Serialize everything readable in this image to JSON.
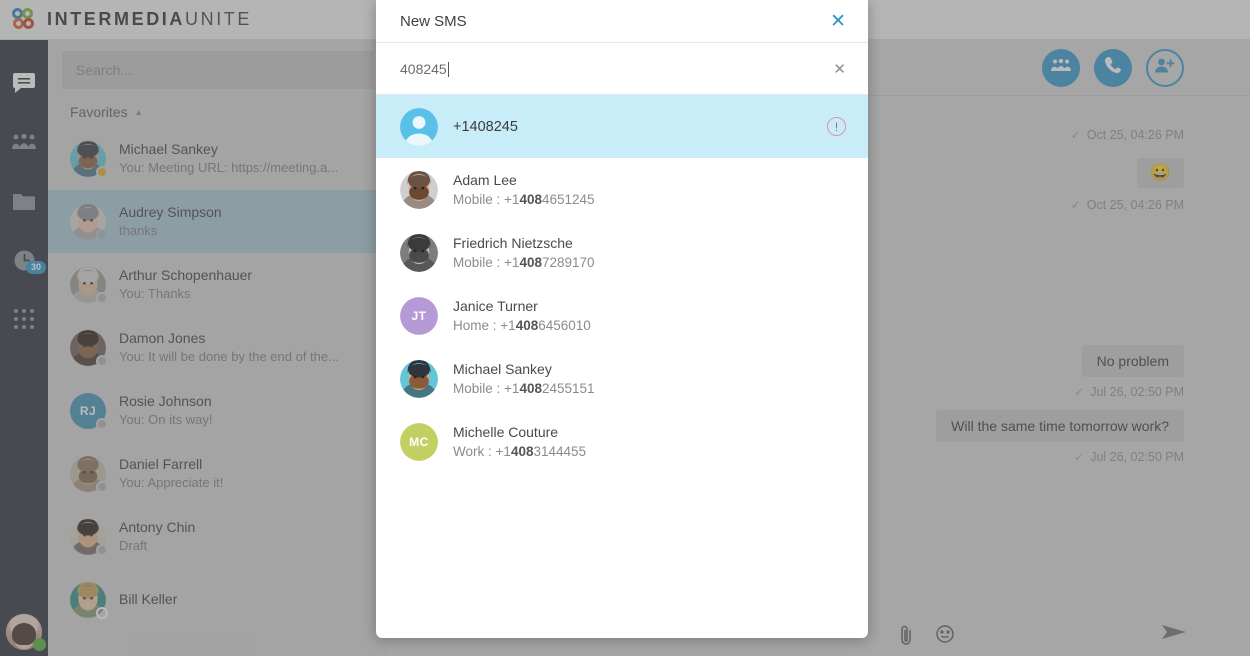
{
  "brand": {
    "name_bold": "INTERMEDIA",
    "name_light": "UNITE"
  },
  "rail": {
    "items": [
      {
        "name": "chat-icon",
        "label": "Chat",
        "badge": ""
      },
      {
        "name": "contacts-icon",
        "label": "Contacts",
        "badge": ""
      },
      {
        "name": "files-icon",
        "label": "Files",
        "badge": ""
      },
      {
        "name": "history-icon",
        "label": "History",
        "badge": "30"
      },
      {
        "name": "dialpad-icon",
        "label": "Dialpad",
        "badge": ""
      }
    ]
  },
  "sidebar": {
    "search_placeholder": "Search...",
    "section_title": "Favorites",
    "conversations": [
      {
        "name": "Michael Sankey",
        "sub": "You: Meeting URL: https://meeting.a...",
        "presence": "away",
        "avatar": "photo-sankey",
        "selected": false
      },
      {
        "name": "Audrey Simpson",
        "sub": "thanks",
        "presence": "offline-grey",
        "avatar": "photo-audrey",
        "selected": true
      },
      {
        "name": "Arthur Schopenhauer",
        "sub": "You: Thanks",
        "presence": "offline-grey",
        "avatar": "photo-arthur",
        "selected": false
      },
      {
        "name": "Damon Jones",
        "sub": "You: It will be done by the end of the...",
        "presence": "offline-grey",
        "avatar": "photo-damon",
        "selected": false
      },
      {
        "name": "Rosie Johnson",
        "sub": "You: On its way!",
        "presence": "offline-grey",
        "avatar": "initials",
        "initials": "RJ",
        "color": "#3f92b5",
        "selected": false
      },
      {
        "name": "Daniel Farrell",
        "sub": "You: Appreciate it!",
        "presence": "offline-grey",
        "avatar": "photo-daniel",
        "selected": false
      },
      {
        "name": "Antony Chin",
        "sub": "Draft",
        "presence": "offline-grey",
        "avatar": "photo-antony",
        "selected": false
      },
      {
        "name": "Bill Keller",
        "sub": "",
        "presence": "offline",
        "avatar": "photo-bill",
        "selected": false
      }
    ]
  },
  "chat": {
    "actions": [
      {
        "name": "meeting-button",
        "icon": "people-icon"
      },
      {
        "name": "call-button",
        "icon": "phone-icon"
      },
      {
        "name": "add-participant-button",
        "icon": "person-add-icon"
      }
    ],
    "messages": [
      {
        "kind": "stamp",
        "text": "Oct 25, 04:26 PM"
      },
      {
        "kind": "bubble-emoji",
        "text": "😀"
      },
      {
        "kind": "stamp",
        "text": "Oct 25, 04:26 PM"
      },
      {
        "kind": "bubble",
        "text": "No problem"
      },
      {
        "kind": "stamp",
        "text": "Jul 26, 02:50 PM"
      },
      {
        "kind": "bubble",
        "text": "Will the same time tomorrow work?"
      },
      {
        "kind": "stamp",
        "text": "Jul 26, 02:50 PM"
      }
    ],
    "composer": {
      "attach_icon": "paperclip-icon",
      "emoji_icon": "emoji-icon",
      "send_icon": "send-icon"
    }
  },
  "modal": {
    "title": "New SMS",
    "close_label": "✕",
    "search_value": "408245",
    "clear_label": "✕",
    "raw_number": {
      "number": "+1408245",
      "warning_icon": "alert-circle-icon"
    },
    "contacts": [
      {
        "name": "Adam Lee",
        "type": "Mobile",
        "prefix": "+1",
        "match": "408",
        "rest": "4651245",
        "avatar": "photo-adam"
      },
      {
        "name": "Friedrich Nietzsche",
        "type": "Mobile",
        "prefix": "+1",
        "match": "408",
        "rest": "7289170",
        "avatar": "photo-friedrich"
      },
      {
        "name": "Janice Turner",
        "type": "Home",
        "prefix": "+1",
        "match": "408",
        "rest": "6456010",
        "avatar": "initials",
        "initials": "JT",
        "color": "#b69ad6"
      },
      {
        "name": "Michael Sankey",
        "type": "Mobile",
        "prefix": "+1",
        "match": "408",
        "rest": "2455151",
        "avatar": "photo-sankey"
      },
      {
        "name": "Michelle Couture",
        "type": "Work",
        "prefix": "+1",
        "match": "408",
        "rest": "3144455",
        "avatar": "initials",
        "initials": "MC",
        "color": "#c2cf61"
      }
    ]
  },
  "colors": {
    "accent": "#2d96cc",
    "highlight": "#c9ecf9",
    "rail_bg": "#252d38",
    "selected_row": "#a9c6d4"
  }
}
